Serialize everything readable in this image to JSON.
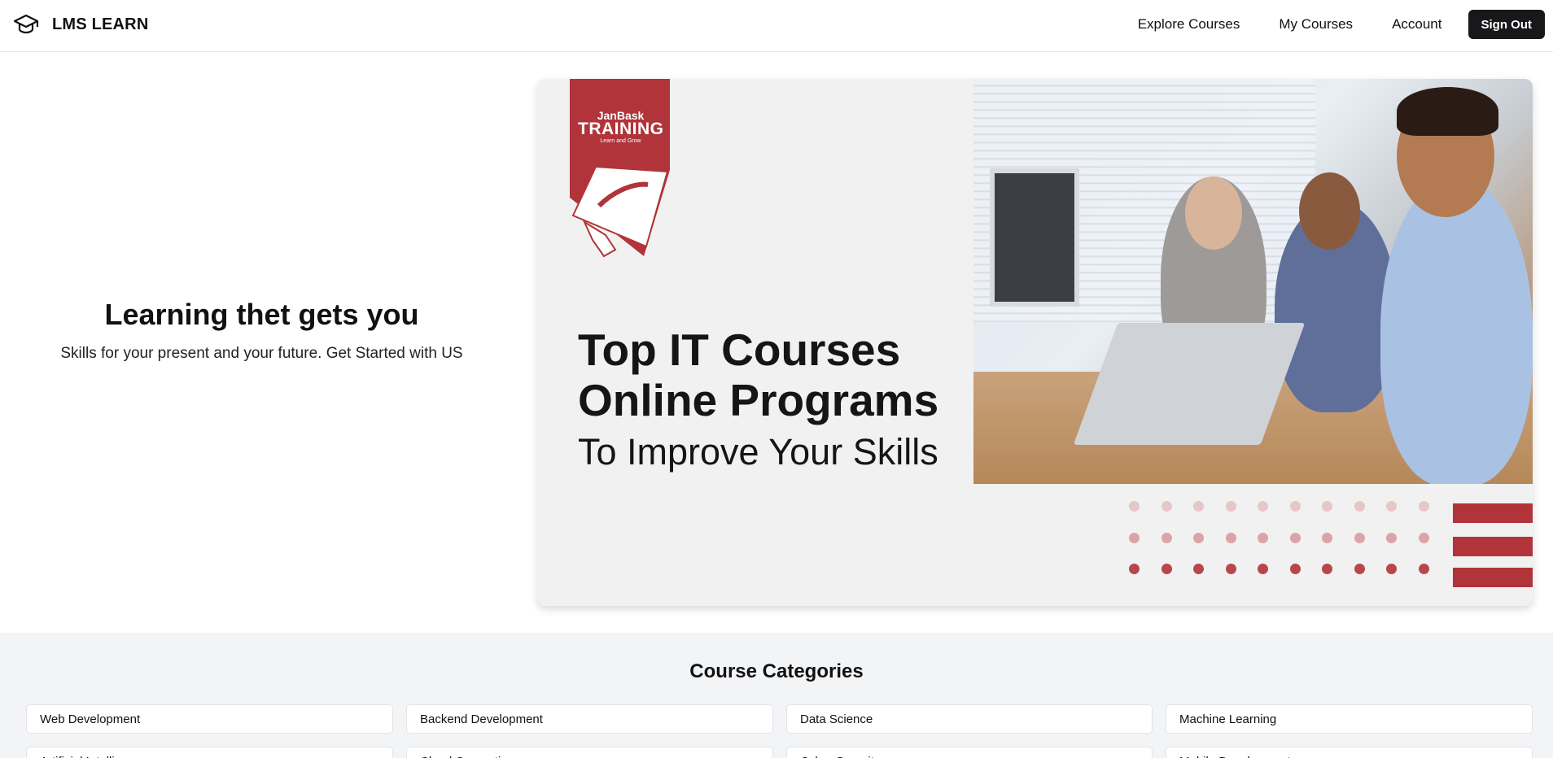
{
  "header": {
    "brand": "LMS LEARN",
    "brand_icon": "graduation-cap-icon",
    "nav": [
      "Explore Courses",
      "My Courses",
      "Account"
    ],
    "signout_label": "Sign Out"
  },
  "hero": {
    "title": "Learning thet gets you",
    "subtitle": "Skills for your present and your future. Get Started with US"
  },
  "banner": {
    "logo_line1": "JanBask",
    "logo_line2": "TRAINING",
    "logo_line3": "Learn and Grow",
    "line1": "Top IT Courses",
    "line2": "Online Programs",
    "line3": "To Improve Your Skills",
    "accent_color": "#b0343a"
  },
  "categories": {
    "title": "Course Categories",
    "items": [
      "Web Development",
      "Backend Development",
      "Data Science",
      "Machine Learning",
      "Artificial Intelligence",
      "Cloud Computing",
      "Cyber Security",
      "Mobile Development"
    ]
  }
}
